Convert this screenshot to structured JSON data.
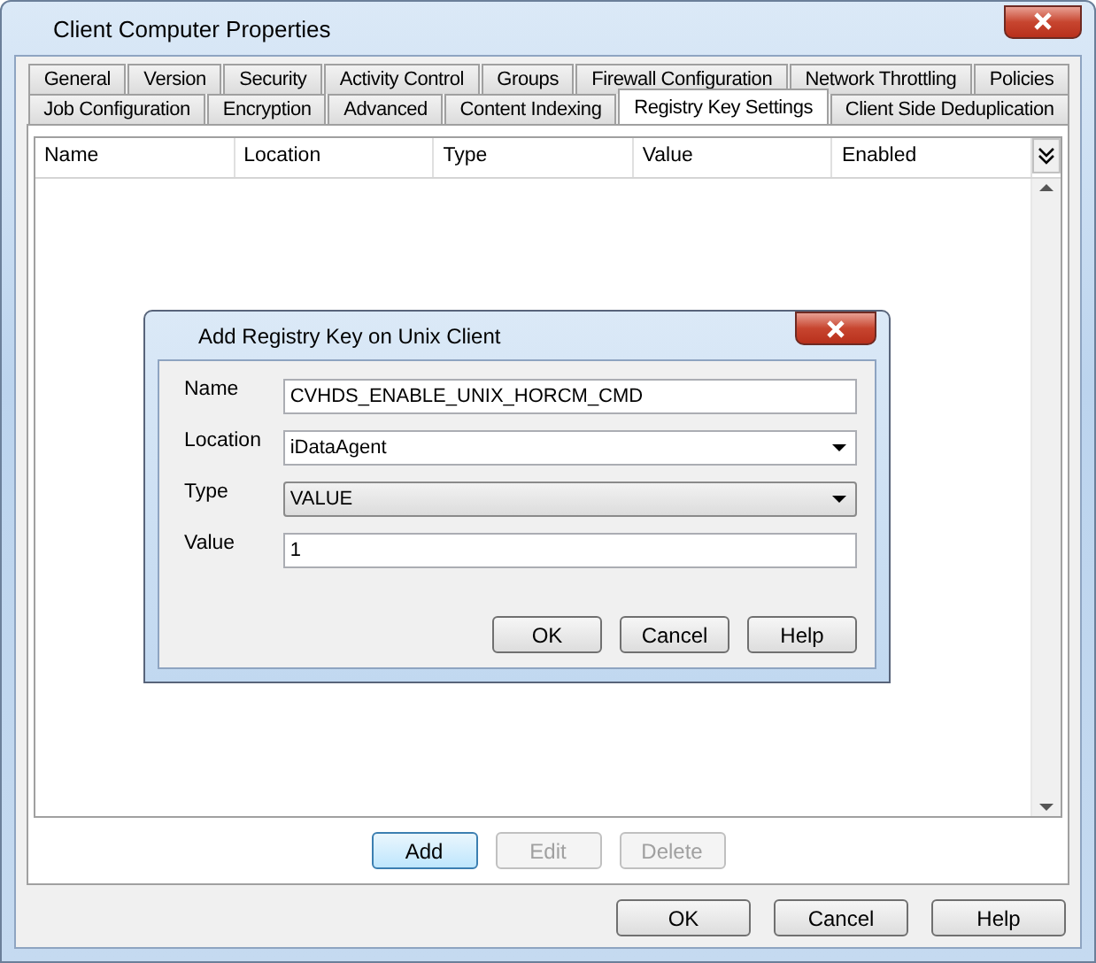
{
  "window": {
    "title": "Client Computer Properties"
  },
  "tab_rows": [
    [
      {
        "label": "General",
        "selected": false
      },
      {
        "label": "Version",
        "selected": false
      },
      {
        "label": "Security",
        "selected": false
      },
      {
        "label": "Activity Control",
        "selected": false
      },
      {
        "label": "Groups",
        "selected": false
      },
      {
        "label": "Firewall Configuration",
        "selected": false
      },
      {
        "label": "Network Throttling",
        "selected": false
      },
      {
        "label": "Policies",
        "selected": false
      }
    ],
    [
      {
        "label": "Job Configuration",
        "selected": false
      },
      {
        "label": "Encryption",
        "selected": false
      },
      {
        "label": "Advanced",
        "selected": false
      },
      {
        "label": "Content Indexing",
        "selected": false
      },
      {
        "label": "Registry Key Settings",
        "selected": true
      },
      {
        "label": "Client Side Deduplication",
        "selected": false
      }
    ]
  ],
  "table": {
    "columns": [
      "Name",
      "Location",
      "Type",
      "Value",
      "Enabled"
    ]
  },
  "table_buttons": [
    {
      "label": "Add",
      "disabled": false,
      "focused": true
    },
    {
      "label": "Edit",
      "disabled": true,
      "focused": false
    },
    {
      "label": "Delete",
      "disabled": true,
      "focused": false
    }
  ],
  "dialog": {
    "title": "Add Registry Key on Unix Client",
    "fields": [
      {
        "label": "Name",
        "kind": "text",
        "value": "CVHDS_ENABLE_UNIX_HORCM_CMD"
      },
      {
        "label": "Location",
        "kind": "combo",
        "value": "iDataAgent"
      },
      {
        "label": "Type",
        "kind": "dropdown",
        "value": "VALUE"
      },
      {
        "label": "Value",
        "kind": "text",
        "value": "1"
      }
    ],
    "buttons": [
      "OK",
      "Cancel",
      "Help"
    ]
  },
  "buttons": [
    "OK",
    "Cancel",
    "Help"
  ]
}
